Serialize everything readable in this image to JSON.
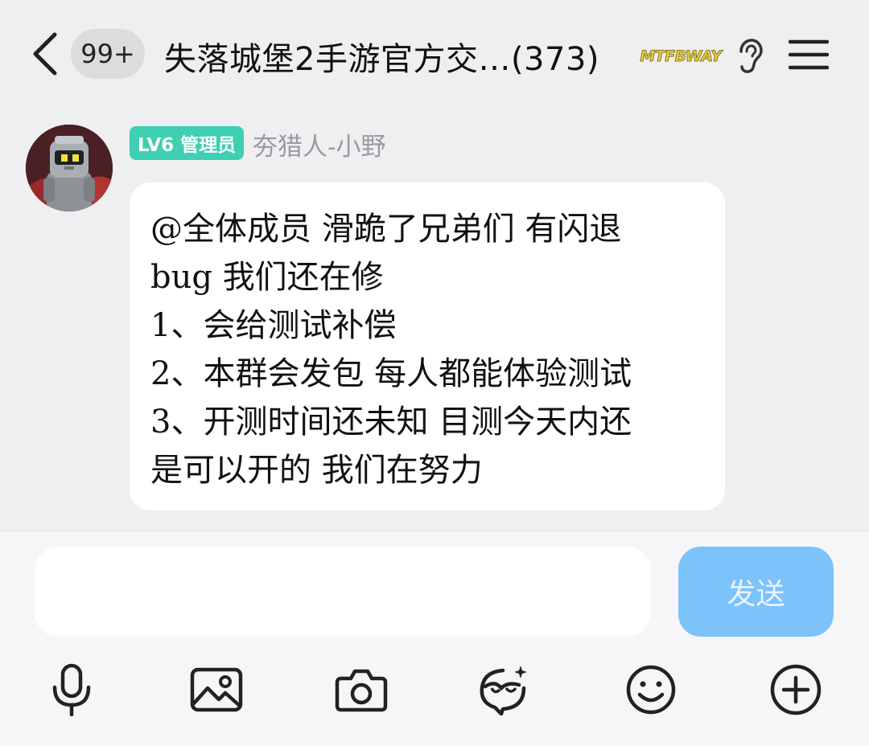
{
  "header": {
    "unread_count": "99+",
    "group_title": "失落城堡2手游官方交…(373)",
    "logo_text": "MTFBWAY"
  },
  "message": {
    "role_badge": "LV6 管理员",
    "sender": "夯猎人-小野",
    "lines": [
      "@全体成员 滑跪了兄弟们 有闪退",
      "bug 我们还在修",
      "1、会给测试补偿",
      "2、本群会发包 每人都能体验测试",
      "3、开测时间还未知 目测今天内还",
      "是可以开的 我们在努力"
    ]
  },
  "composer": {
    "input_value": "",
    "send_label": "发送"
  },
  "toolbar": {
    "icons": [
      "microphone-icon",
      "image-icon",
      "camera-icon",
      "sticker-icon",
      "emoji-icon",
      "plus-icon"
    ]
  },
  "colors": {
    "background": "#efeff2",
    "role_badge": "#3fcfb3",
    "send_button": "#7cc2fb",
    "bubble": "#ffffff"
  }
}
